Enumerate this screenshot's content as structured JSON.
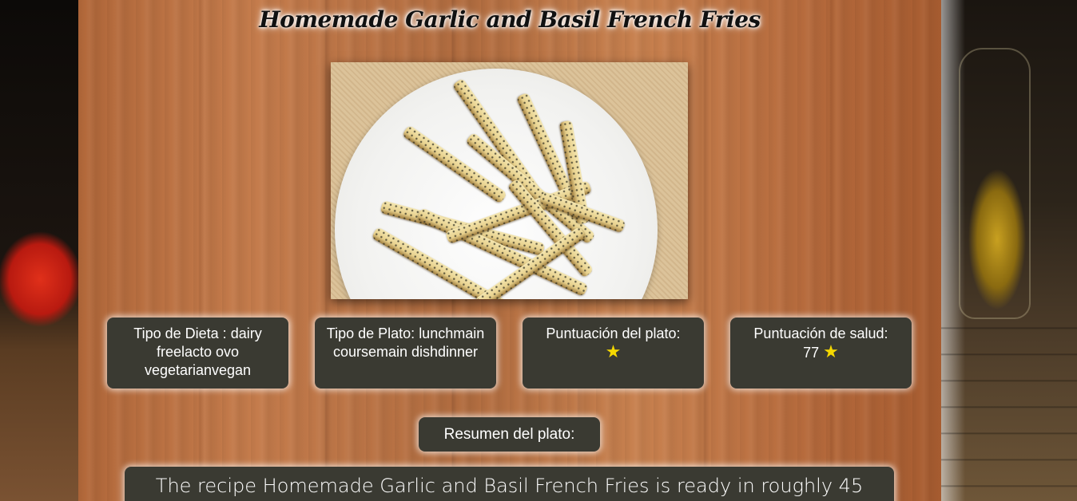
{
  "recipe": {
    "title": "Homemade Garlic and Basil French Fries",
    "image_alt": "Homemade Garlic and Basil French Fries"
  },
  "cards": {
    "diet": {
      "label": "Tipo de Dieta :",
      "value": "dairy freelacto ovo vegetarianvegan"
    },
    "dish_type": {
      "label": "Tipo de Plato:",
      "value": "lunchmain coursemain dishdinner"
    },
    "dish_score": {
      "label": "Puntuación del plato:",
      "value": "",
      "icon": "star-icon",
      "stars": 1
    },
    "health_score": {
      "label": "Puntuación de salud:",
      "value": "77",
      "icon": "star-icon",
      "stars": 1
    }
  },
  "summary": {
    "button_label": "Resumen del plato:",
    "text": "The recipe Homemade Garlic and Basil French Fries is ready in roughly 45"
  },
  "colors": {
    "card_bg": "#3a3a32",
    "star": "#f5d800",
    "wood": "#c57c4c"
  }
}
